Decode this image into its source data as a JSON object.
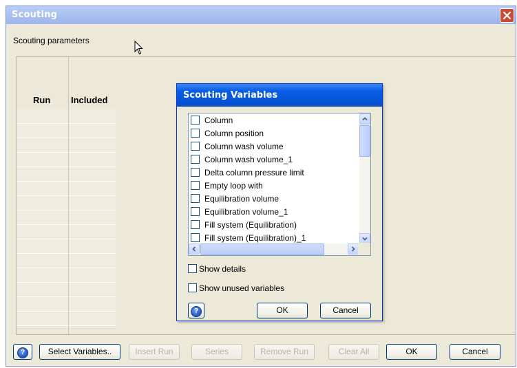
{
  "window": {
    "title": "Scouting",
    "params_label": "Scouting parameters",
    "columns": [
      "Run",
      "Included"
    ]
  },
  "bottom_buttons": {
    "select_variables": "Select Variables..",
    "insert_run": "Insert Run",
    "series": "Series",
    "remove_run": "Remove Run",
    "clear_all": "Clear All",
    "ok": "OK",
    "cancel": "Cancel"
  },
  "dialog": {
    "title": "Scouting Variables",
    "variables": [
      {
        "label": "Column",
        "checked": false
      },
      {
        "label": "Column position",
        "checked": false
      },
      {
        "label": "Column wash volume",
        "checked": false
      },
      {
        "label": "Column wash volume_1",
        "checked": false
      },
      {
        "label": "Delta column pressure limit",
        "checked": false
      },
      {
        "label": "Empty loop with",
        "checked": false
      },
      {
        "label": "Equilibration volume",
        "checked": false
      },
      {
        "label": "Equilibration volume_1",
        "checked": false
      },
      {
        "label": "Fill system (Equilibration)",
        "checked": false
      },
      {
        "label": "Fill system (Equilibration)_1",
        "checked": false
      }
    ],
    "show_details": "Show details",
    "show_unused": "Show unused variables",
    "ok": "OK",
    "cancel": "Cancel"
  },
  "icons": {
    "help": "help-icon",
    "close": "close-icon",
    "cursor": "mouse-cursor-icon"
  },
  "colors": {
    "title_active": "#0554d9",
    "title_inactive": "#a8bff0",
    "close": "#c94a35",
    "face": "#ece9d8"
  }
}
